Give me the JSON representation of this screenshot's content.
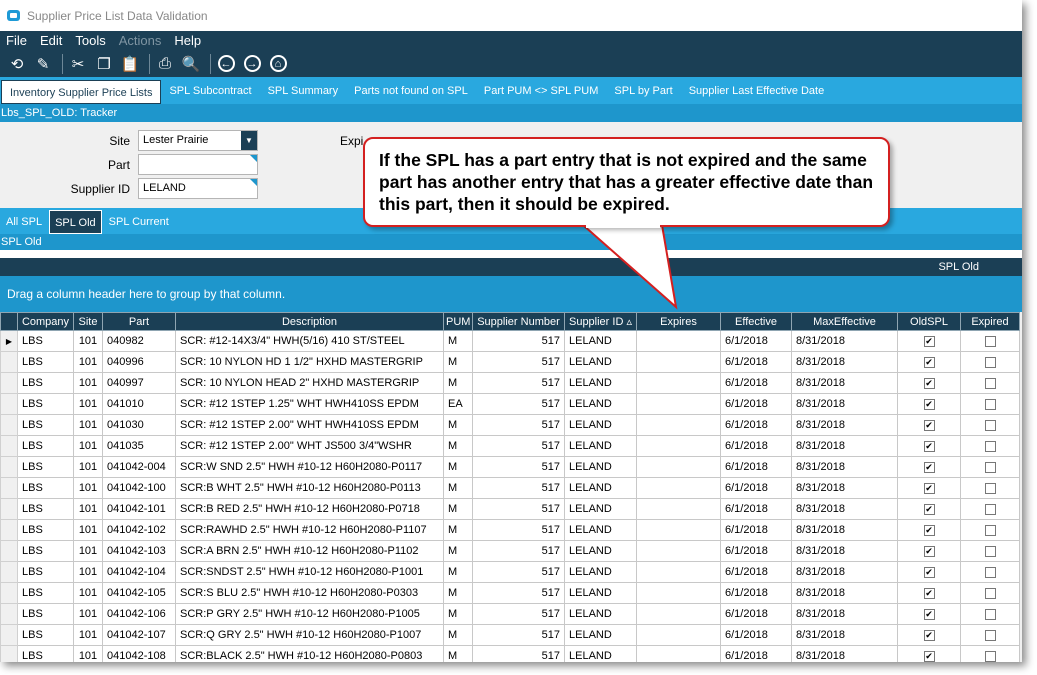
{
  "window": {
    "title": "Supplier Price List Data Validation"
  },
  "menu": [
    {
      "label": "File",
      "enabled": true
    },
    {
      "label": "Edit",
      "enabled": true
    },
    {
      "label": "Tools",
      "enabled": true
    },
    {
      "label": "Actions",
      "enabled": false
    },
    {
      "label": "Help",
      "enabled": true
    }
  ],
  "toolbar": [
    "refresh-icon",
    "clear-icon",
    "cut-icon",
    "copy-icon",
    "paste-icon",
    "print-icon",
    "print-preview-icon",
    "back-icon",
    "forward-icon",
    "home-icon"
  ],
  "main_tabs": [
    "Inventory Supplier Price Lists",
    "SPL Subcontract",
    "SPL Summary",
    "Parts not found on SPL",
    "Part PUM <> SPL PUM",
    "SPL by Part",
    "Supplier Last Effective Date"
  ],
  "tracker_label": "Lbs_SPL_OLD: Tracker",
  "form": {
    "site_label": "Site",
    "site_value": "Lester Prairie",
    "part_label": "Part",
    "part_value": "",
    "supplier_label": "Supplier ID",
    "supplier_value": "LELAND",
    "expired_label": "Expi"
  },
  "sub_tabs": [
    "All SPL",
    "SPL Old",
    "SPL Current"
  ],
  "panel_title": "SPL Old",
  "grid": {
    "title": "SPL Old",
    "group_hint": "Drag a column header here to group by that column.",
    "columns": [
      "Company",
      "Site",
      "Part",
      "Description",
      "PUM",
      "Supplier Number",
      "Supplier ID",
      "Expires",
      "Effective",
      "MaxEffective",
      "OldSPL",
      "Expired"
    ],
    "rows": [
      [
        "LBS",
        "101",
        "040982",
        "SCR: #12-14X3/4\" HWH(5/16) 410 ST/STEEL",
        "M",
        "517",
        "LELAND",
        "",
        "6/1/2018",
        "8/31/2018",
        true,
        false
      ],
      [
        "LBS",
        "101",
        "040996",
        "SCR: 10 NYLON HD 1 1/2\" HXHD MASTERGRIP",
        "M",
        "517",
        "LELAND",
        "",
        "6/1/2018",
        "8/31/2018",
        true,
        false
      ],
      [
        "LBS",
        "101",
        "040997",
        "SCR: 10 NYLON HEAD   2\" HXHD MASTERGRIP",
        "M",
        "517",
        "LELAND",
        "",
        "6/1/2018",
        "8/31/2018",
        true,
        false
      ],
      [
        "LBS",
        "101",
        "041010",
        "SCR: #12 1STEP 1.25\" WHT HWH410SS EPDM",
        "EA",
        "517",
        "LELAND",
        "",
        "6/1/2018",
        "8/31/2018",
        true,
        false
      ],
      [
        "LBS",
        "101",
        "041030",
        "SCR: #12 1STEP 2.00\" WHT HWH410SS EPDM",
        "M",
        "517",
        "LELAND",
        "",
        "6/1/2018",
        "8/31/2018",
        true,
        false
      ],
      [
        "LBS",
        "101",
        "041035",
        "SCR: #12 1STEP 2.00\" WHT JS500 3/4\"WSHR",
        "M",
        "517",
        "LELAND",
        "",
        "6/1/2018",
        "8/31/2018",
        true,
        false
      ],
      [
        "LBS",
        "101",
        "041042-004",
        "SCR:W SND 2.5\" HWH #10-12 H60H2080-P0117",
        "M",
        "517",
        "LELAND",
        "",
        "6/1/2018",
        "8/31/2018",
        true,
        false
      ],
      [
        "LBS",
        "101",
        "041042-100",
        "SCR:B WHT 2.5\" HWH #10-12 H60H2080-P0113",
        "M",
        "517",
        "LELAND",
        "",
        "6/1/2018",
        "8/31/2018",
        true,
        false
      ],
      [
        "LBS",
        "101",
        "041042-101",
        "SCR:B RED 2.5\" HWH #10-12 H60H2080-P0718",
        "M",
        "517",
        "LELAND",
        "",
        "6/1/2018",
        "8/31/2018",
        true,
        false
      ],
      [
        "LBS",
        "101",
        "041042-102",
        "SCR:RAWHD 2.5\" HWH #10-12 H60H2080-P1107",
        "M",
        "517",
        "LELAND",
        "",
        "6/1/2018",
        "8/31/2018",
        true,
        false
      ],
      [
        "LBS",
        "101",
        "041042-103",
        "SCR:A BRN 2.5\" HWH #10-12 H60H2080-P1102",
        "M",
        "517",
        "LELAND",
        "",
        "6/1/2018",
        "8/31/2018",
        true,
        false
      ],
      [
        "LBS",
        "101",
        "041042-104",
        "SCR:SNDST 2.5\" HWH #10-12 H60H2080-P1001",
        "M",
        "517",
        "LELAND",
        "",
        "6/1/2018",
        "8/31/2018",
        true,
        false
      ],
      [
        "LBS",
        "101",
        "041042-105",
        "SCR:S BLU 2.5\" HWH #10-12 H60H2080-P0303",
        "M",
        "517",
        "LELAND",
        "",
        "6/1/2018",
        "8/31/2018",
        true,
        false
      ],
      [
        "LBS",
        "101",
        "041042-106",
        "SCR:P GRY 2.5\" HWH #10-12 H60H2080-P1005",
        "M",
        "517",
        "LELAND",
        "",
        "6/1/2018",
        "8/31/2018",
        true,
        false
      ],
      [
        "LBS",
        "101",
        "041042-107",
        "SCR:Q GRY 2.5\" HWH #10-12 H60H2080-P1007",
        "M",
        "517",
        "LELAND",
        "",
        "6/1/2018",
        "8/31/2018",
        true,
        false
      ],
      [
        "LBS",
        "101",
        "041042-108",
        "SCR:BLACK 2.5\" HWH #10-12 H60H2080-P0803",
        "M",
        "517",
        "LELAND",
        "",
        "6/1/2018",
        "8/31/2018",
        true,
        false
      ]
    ]
  },
  "callout": {
    "text": "If the SPL has a part entry that is not expired and the same part has another entry that has a greater effective date than this part, then it should be expired."
  },
  "colors": {
    "navy": "#1b3f55",
    "accent": "#29a8df",
    "callout_border": "#d42020"
  }
}
